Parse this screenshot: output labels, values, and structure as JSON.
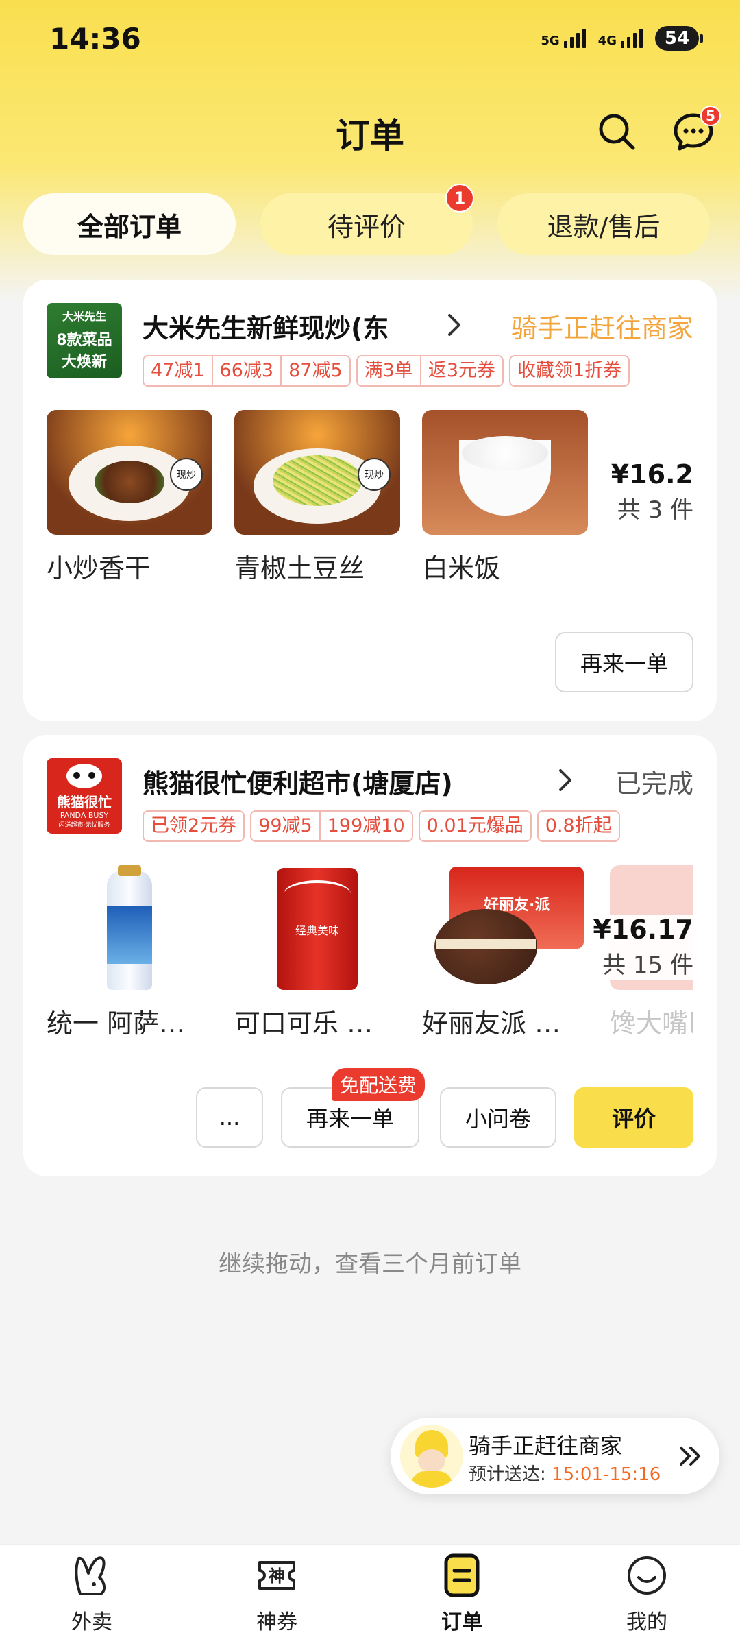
{
  "status_bar": {
    "time": "14:36",
    "net1": "5G",
    "net2": "4G",
    "battery": "54"
  },
  "header": {
    "title": "订单",
    "message_badge": "5"
  },
  "tabs": [
    {
      "label": "全部订单",
      "active": true
    },
    {
      "label": "待评价",
      "badge": "1"
    },
    {
      "label": "退款/售后"
    }
  ],
  "orders": [
    {
      "logo_lines": [
        "大米先生",
        "8款菜品",
        "大焕新"
      ],
      "store_name": "大米先生新鲜现炒(东",
      "status": "骑手正赶往商家",
      "status_color": "#f3a43a",
      "promos": [
        [
          "47减1",
          "66减3",
          "87减5"
        ],
        [
          "满3单",
          "返3元券"
        ],
        [
          "收藏领1折券"
        ]
      ],
      "items": [
        {
          "name": "小炒香干",
          "tag": "现炒"
        },
        {
          "name": "青椒土豆丝",
          "tag": "现炒"
        },
        {
          "name": "白米饭"
        }
      ],
      "price": "¥16.2",
      "count": "共 3 件",
      "buttons": {
        "reorder": "再来一单"
      }
    },
    {
      "logo_lines": [
        "熊猫很忙",
        "PANDA BUSY",
        "闪送超市·无忧服务"
      ],
      "store_name": "熊猫很忙便利超市(塘厦店)",
      "status": "已完成",
      "status_color": "#555555",
      "promos": [
        [
          "已领2元券"
        ],
        [
          "99减5",
          "199减10"
        ],
        [
          "0.01元爆品"
        ],
        [
          "0.8折起"
        ]
      ],
      "items": [
        {
          "name": "统一 阿萨…"
        },
        {
          "name": "可口可乐 …",
          "can_text": "经典美味"
        },
        {
          "name": "好丽友派 …",
          "pack_text": "好丽友·派"
        },
        {
          "name": "馋大嘴巴"
        }
      ],
      "price": "¥16.17",
      "count": "共 15 件",
      "buttons": {
        "more": "...",
        "reorder": "再来一单",
        "reorder_tag": "免配送费",
        "survey": "小问卷",
        "review": "评价"
      }
    }
  ],
  "more_hint": "继续拖动，查看三个月前订单",
  "rider": {
    "title": "骑手正赶往商家",
    "eta_label": "预计送达:",
    "eta_time": "15:01-15:16"
  },
  "bottom_nav": [
    {
      "label": "外卖",
      "icon": "rabbit-icon"
    },
    {
      "label": "神券",
      "icon": "coupon-icon"
    },
    {
      "label": "订单",
      "icon": "order-list-icon",
      "active": true
    },
    {
      "label": "我的",
      "icon": "smile-icon"
    }
  ],
  "colors": {
    "accent_yellow": "#f9dd4a",
    "promo_red": "#e54d3d",
    "badge_red": "#ea3b2e",
    "eta_orange": "#f06a24"
  }
}
